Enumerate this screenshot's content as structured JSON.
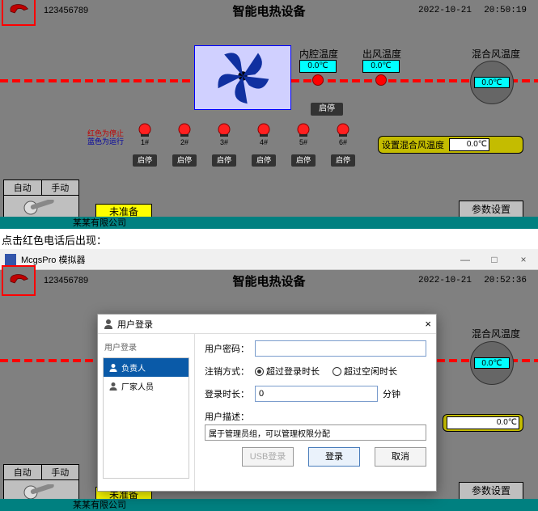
{
  "header": {
    "phone_number": "123456789",
    "title": "智能电热设备",
    "date": "2022-10-21",
    "time1": "20:50:19",
    "time2": "20:52:36"
  },
  "temps": {
    "inner_label": "内腔温度",
    "inner_value": "0.0℃",
    "outlet_label": "出风温度",
    "outlet_value": "0.0℃",
    "mix_label": "混合风温度",
    "mix_value": "0.0℃"
  },
  "main_stop": "启停",
  "legend": {
    "line1": "红色为停止",
    "line2": "蓝色为运行"
  },
  "heaters": [
    {
      "label": "1#",
      "btn": "启停"
    },
    {
      "label": "2#",
      "btn": "启停"
    },
    {
      "label": "3#",
      "btn": "启停"
    },
    {
      "label": "4#",
      "btn": "启停"
    },
    {
      "label": "5#",
      "btn": "启停"
    },
    {
      "label": "6#",
      "btn": "启停"
    }
  ],
  "setmix": {
    "label": "设置混合风温度",
    "value": "0.0℃"
  },
  "mode": {
    "auto": "自动",
    "manual": "手动"
  },
  "ready": "未准备",
  "param_btn": "参数设置",
  "footer": "某某有限公司",
  "caption": "点击红色电话后出现：",
  "window": {
    "title": "McgsPro 模拟器",
    "min": "—",
    "max": "□",
    "close": "×"
  },
  "dialog": {
    "title": "用户登录",
    "left_title": "用户登录",
    "users": [
      {
        "name": "负责人",
        "selected": true
      },
      {
        "name": "厂家人员",
        "selected": false
      }
    ],
    "pwd_label": "用户密码：",
    "pwd_value": "",
    "logout_label": "注销方式：",
    "logout_opts": [
      "超过登录时长",
      "超过空闲时长"
    ],
    "duration_label": "登录时长：",
    "duration_value": "0",
    "duration_unit": "分钟",
    "desc_label": "用户描述：",
    "desc_value": "属于管理员组，可以管理权限分配",
    "btn_usb": "USB登录",
    "btn_login": "登录",
    "btn_cancel": "取消"
  }
}
